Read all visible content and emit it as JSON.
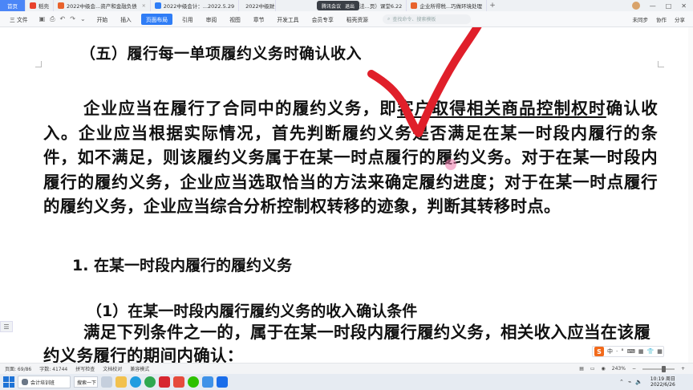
{
  "tabs": {
    "home": "首页",
    "t1": "稻壳",
    "t2": "2022中级会...资产和金融负债",
    "t3": "2022中级会计：...2022.5.29",
    "t4": "2022中级财务...",
    "t5": "2022年：税法...页）课堂6.22",
    "t6": "企业所得税...巧做环境处理",
    "plus": "+"
  },
  "meeting": {
    "label1": "腾讯会议",
    "label2": "退出"
  },
  "window_controls": {
    "min": "—",
    "max": "□",
    "close": "✕"
  },
  "ribbon": {
    "file": "三 文件",
    "items": [
      "开始",
      "插入",
      "页面布局",
      "引用",
      "审阅",
      "视图",
      "章节",
      "开发工具",
      "会员专享",
      "稻壳资源"
    ],
    "active_index": 2,
    "search_placeholder": "查找命令、搜索模板",
    "right": [
      "未同步",
      "协作",
      "分享"
    ]
  },
  "document": {
    "heading": "（五）履行每一单项履约义务时确认收入",
    "para_pre": "企业应当在履行了合同中的履约义务，即",
    "para_ul": "客户取得相关商品控制权时",
    "para_post": "确认收入。企业应当根据实际情况，首先判断履约义务是否满足在某一时段内履行的条件，如不满足，则该履约义务属于在某一时点履行的履约义务。对于在某一时段内履行的履约义务，企业应当选取恰当的方法来确定履约进度；对于在某一时点履行的履约义务，企业应当综合分析控制权转移的迹象，判断其转移时点。",
    "sub1": "1. 在某一时段内履行的履约义务",
    "sub2": "（1）在某一时段内履行履约义务的收入确认条件",
    "para2": "满足下列条件之一的，属于在某一时段内履行履约义务，相关收入应当在该履约义务履行的期间内确认："
  },
  "ime": {
    "logo": "S",
    "items": [
      "中",
      "·",
      "°",
      "⌨",
      "▦",
      "👕",
      "▦"
    ]
  },
  "status": {
    "page": "页面: 69/86",
    "words": "字数: 41744",
    "spell": "拼写检查",
    "proof": "文档校对",
    "compat": "兼容模式",
    "zoom": "243%"
  },
  "taskbar": {
    "app_label": "会计培训班",
    "search_label": "搜索一下",
    "time": "10:19 周日",
    "date": "2022/6/26"
  },
  "colors": {
    "accent": "#2f7df6",
    "checkmark": "#e01f2a"
  }
}
